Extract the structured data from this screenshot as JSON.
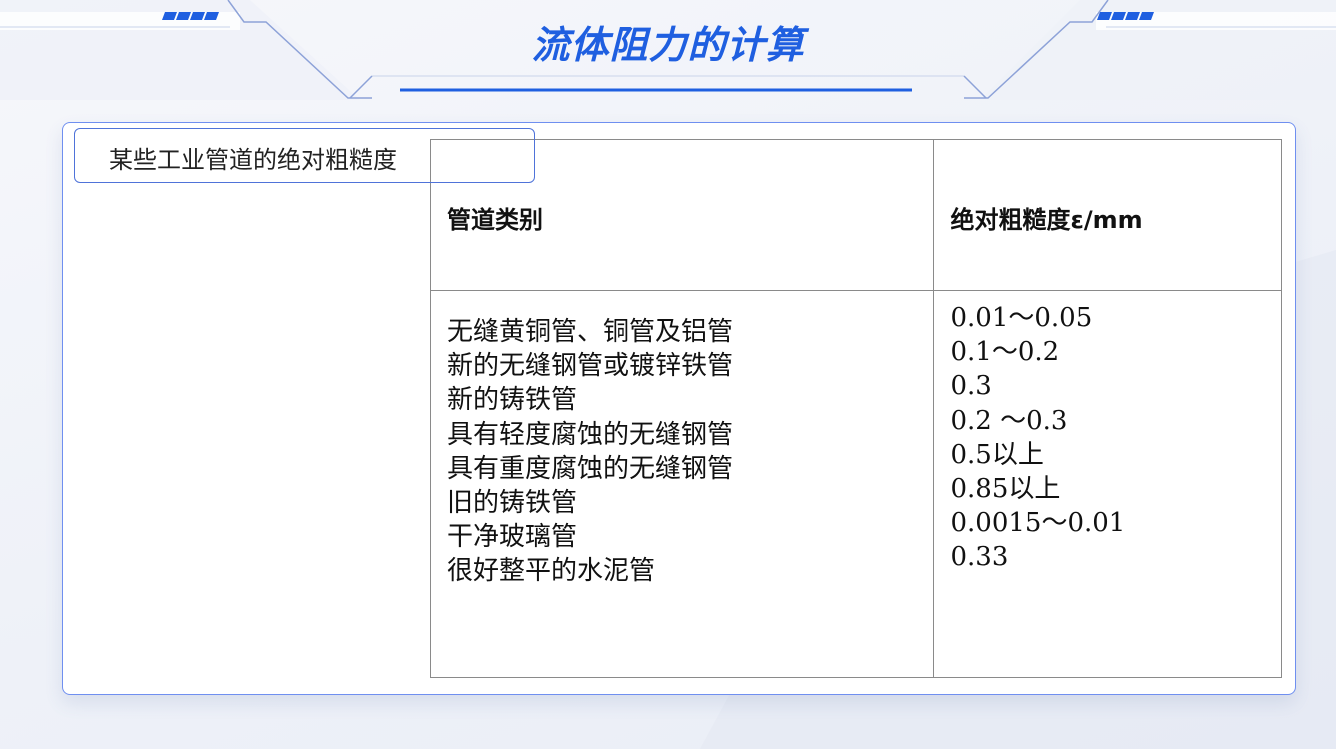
{
  "header": {
    "title": "流体阻力的计算"
  },
  "card": {
    "label": "某些工业管道的绝对粗糙度"
  },
  "table": {
    "headers": [
      "管道类别",
      "绝对粗糙度ε/mm"
    ],
    "categories": [
      "无缝黄铜管、铜管及铝管",
      "新的无缝钢管或镀锌铁管",
      "新的铸铁管",
      "具有轻度腐蚀的无缝钢管",
      "具有重度腐蚀的无缝钢管",
      "旧的铸铁管",
      "干净玻璃管",
      "很好整平的水泥管"
    ],
    "roughness": [
      "0.01～0.05",
      "0.1～0.2",
      "0.3",
      "0.2 ～0.3",
      "0.5以上",
      "0.85以上",
      "0.0015～0.01",
      "0.33"
    ]
  },
  "colors": {
    "accent": "#1f5fe0",
    "border": "#6f8ff0"
  }
}
